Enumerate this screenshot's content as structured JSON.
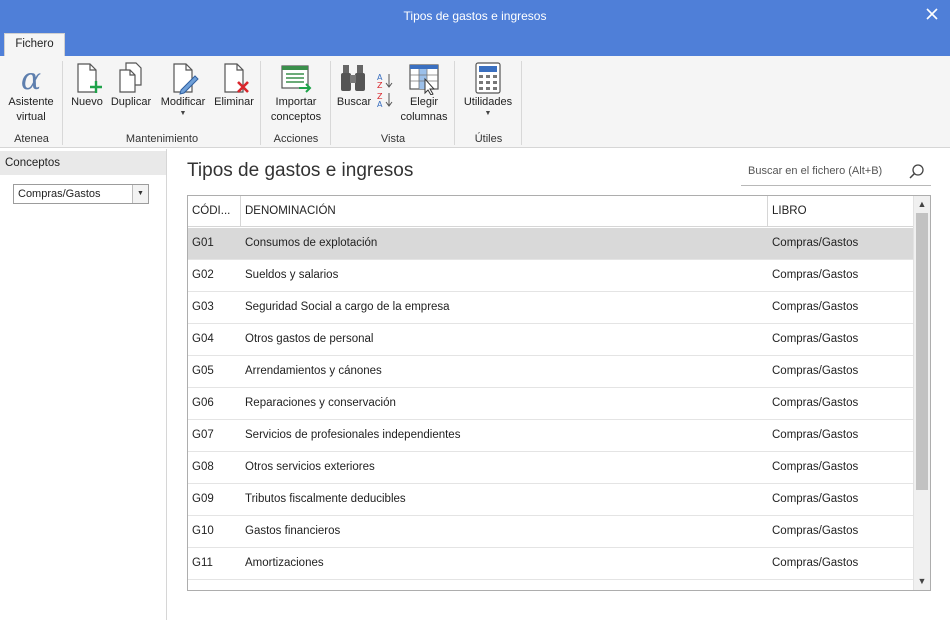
{
  "window": {
    "title": "Tipos de gastos e ingresos"
  },
  "ribbon": {
    "tab": "Fichero",
    "groups": [
      {
        "label": "Atenea",
        "buttons": [
          {
            "line1": "Asistente",
            "line2": "virtual",
            "icon": "alpha-icon"
          }
        ]
      },
      {
        "label": "Mantenimiento",
        "buttons": [
          {
            "line1": "Nuevo",
            "icon": "new-document-icon"
          },
          {
            "line1": "Duplicar",
            "icon": "duplicate-icon"
          },
          {
            "line1": "Modificar",
            "icon": "edit-icon",
            "dropdown": true
          },
          {
            "line1": "Eliminar",
            "icon": "delete-icon"
          }
        ]
      },
      {
        "label": "Acciones",
        "buttons": [
          {
            "line1": "Importar",
            "line2": "conceptos",
            "icon": "import-icon"
          }
        ]
      },
      {
        "label": "Vista",
        "buttons": [
          {
            "line1": "Buscar",
            "icon": "binoculars-icon"
          },
          {
            "line1": "",
            "icon": "sort-icon"
          },
          {
            "line1": "Elegir",
            "line2": "columnas",
            "icon": "columns-icon"
          }
        ]
      },
      {
        "label": "Útiles",
        "buttons": [
          {
            "line1": "Utilidades",
            "icon": "calculator-icon",
            "dropdown": true
          }
        ]
      }
    ]
  },
  "sidebar": {
    "header": "Conceptos",
    "combo_value": "Compras/Gastos"
  },
  "main": {
    "title": "Tipos de gastos e ingresos",
    "search_placeholder": "Buscar en el fichero (Alt+B)"
  },
  "table": {
    "columns": [
      "CÓDI...",
      "DENOMINACIÓN",
      "LIBRO"
    ],
    "rows": [
      [
        "G01",
        "Consumos de explotación",
        "Compras/Gastos"
      ],
      [
        "G02",
        "Sueldos y salarios",
        "Compras/Gastos"
      ],
      [
        "G03",
        "Seguridad Social a cargo de la empresa",
        "Compras/Gastos"
      ],
      [
        "G04",
        "Otros gastos de personal",
        "Compras/Gastos"
      ],
      [
        "G05",
        "Arrendamientos y cánones",
        "Compras/Gastos"
      ],
      [
        "G06",
        "Reparaciones y conservación",
        "Compras/Gastos"
      ],
      [
        "G07",
        "Servicios de profesionales independientes",
        "Compras/Gastos"
      ],
      [
        "G08",
        "Otros servicios exteriores",
        "Compras/Gastos"
      ],
      [
        "G09",
        "Tributos fiscalmente deducibles",
        "Compras/Gastos"
      ],
      [
        "G10",
        "Gastos financieros",
        "Compras/Gastos"
      ],
      [
        "G11",
        "Amortizaciones",
        "Compras/Gastos"
      ]
    ],
    "selected_row": 0
  },
  "colors": {
    "titlebar": "#4f7fd8",
    "selected_row": "#d9d9d9",
    "ribbon_bg": "#f5f5f5"
  }
}
